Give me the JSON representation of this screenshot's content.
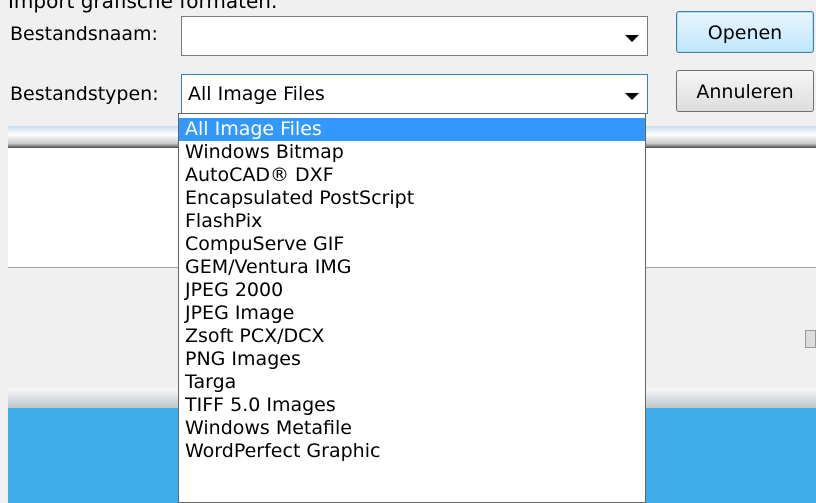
{
  "window": {
    "title_fragment": "Import grafische formaten."
  },
  "form": {
    "filename_label": "Bestandsnaam:",
    "filename_value": "",
    "filetype_label": "Bestandstypen:",
    "filetype_value": "All Image Files"
  },
  "buttons": {
    "open": "Openen",
    "cancel": "Annuleren"
  },
  "dropdown": {
    "options": [
      "All Image Files",
      "Windows Bitmap",
      "AutoCAD® DXF",
      "Encapsulated PostScript",
      "FlashPix",
      "CompuServe GIF",
      "GEM/Ventura IMG",
      "JPEG 2000",
      "JPEG Image",
      "Zsoft PCX/DCX",
      "PNG Images",
      "Targa",
      "TIFF 5.0 Images",
      "Windows Metafile",
      "WordPerfect Graphic"
    ],
    "selected_index": 0
  },
  "colors": {
    "selection": "#3399ff",
    "accent_blue": "#3eadea"
  }
}
